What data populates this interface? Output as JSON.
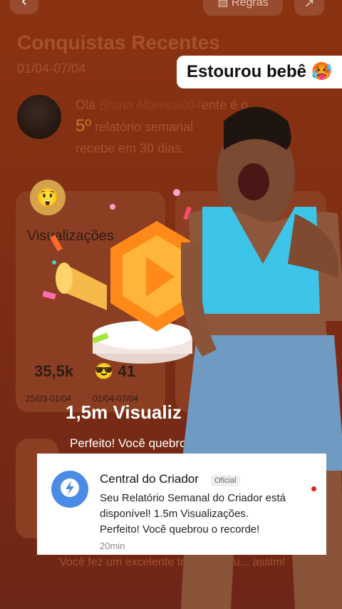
{
  "header": {
    "rules_label": "Regras"
  },
  "page": {
    "title": "Conquistas Recentes",
    "date_range": "01/04-07/04",
    "greeting_prefix": "Olá ",
    "username": "Bruna Moreira084",
    "greeting_mid": "ente é o",
    "rank": "5º",
    "greeting_rest": " relatório semanal ",
    "greeting_end": "recebe em 30 dias."
  },
  "card": {
    "title": "Visualizações",
    "stat_prev": "35,5k",
    "stat_curr": "41",
    "date_prev": "25/03-01/04",
    "date_curr": "01/04-07/04"
  },
  "overlay": {
    "views_headline": "1,5m Visualiz",
    "perfect_text": "Perfeito! Você quebro",
    "caption": "Estourou bebê 🥵"
  },
  "footer": {
    "text": "Você fez um excelente tra... continu... assim!"
  },
  "notification": {
    "app_name": "Central do Criador",
    "badge": "Oficial",
    "body": "Seu Relatório Semanal do Criador está disponível! 1.5m Visualizações. Perfeito! Você quebrou o recorde!",
    "time": "20min"
  }
}
